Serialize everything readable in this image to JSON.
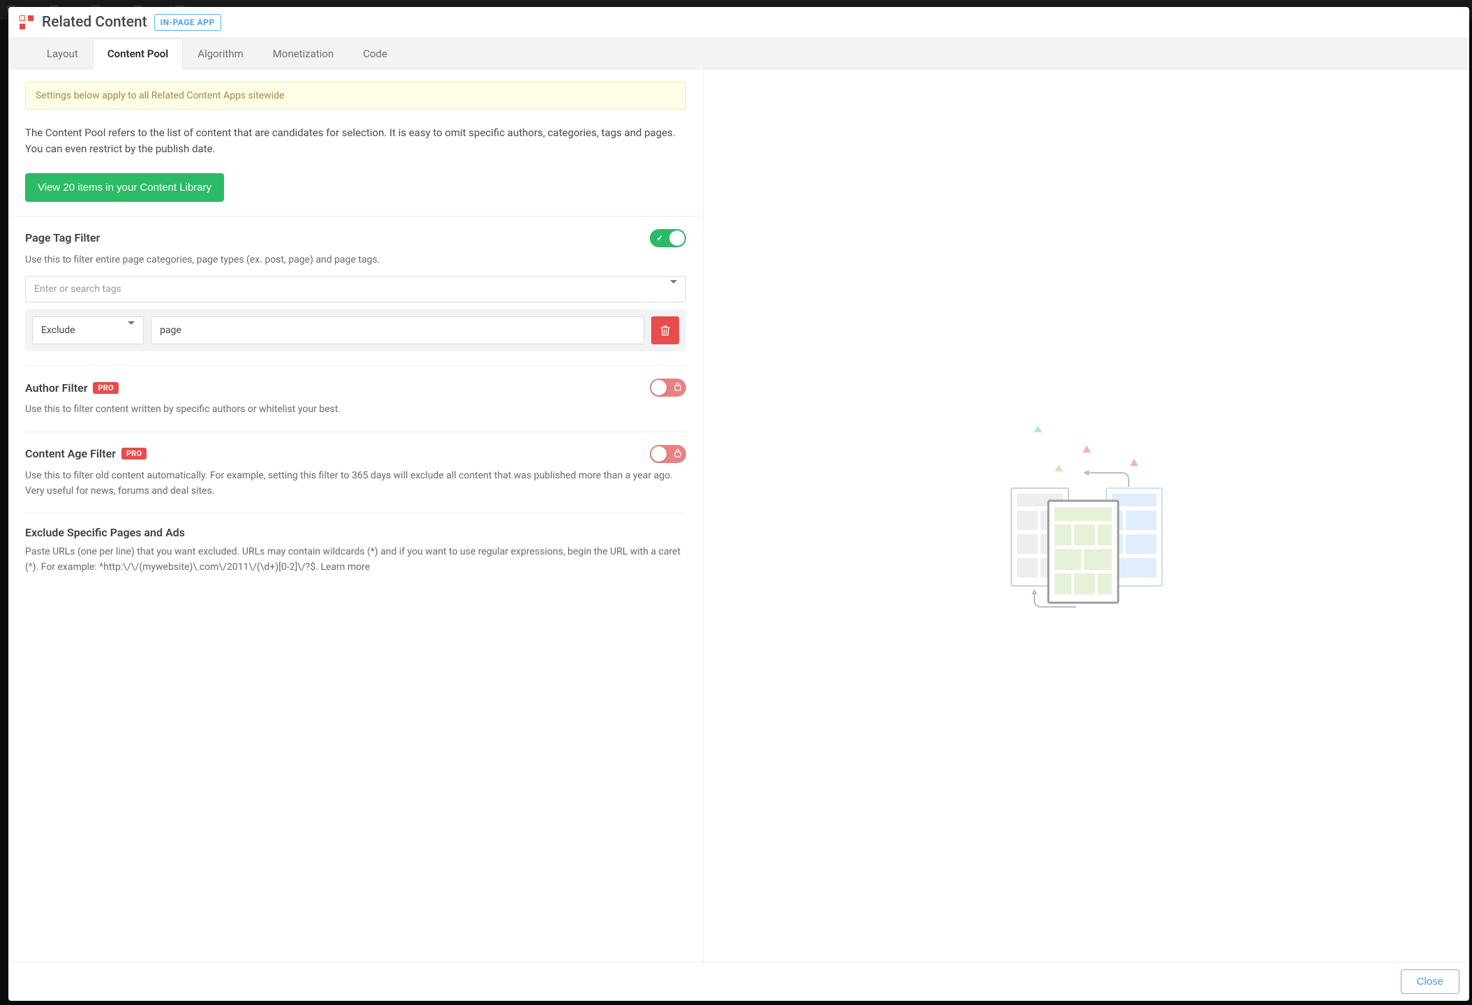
{
  "header": {
    "title": "Related Content",
    "badge": "IN-PAGE APP"
  },
  "tabs": [
    {
      "label": "Layout",
      "active": false
    },
    {
      "label": "Content Pool",
      "active": true
    },
    {
      "label": "Algorithm",
      "active": false
    },
    {
      "label": "Monetization",
      "active": false
    },
    {
      "label": "Code",
      "active": false
    }
  ],
  "notice": "Settings below apply to all Related Content Apps sitewide",
  "intro": "The Content Pool refers to the list of content that are candidates for selection. It is easy to omit specific authors, categories, tags and pages. You can even restrict by the publish date.",
  "view_library_btn": "View 20 items in your Content Library",
  "page_tag_filter": {
    "title": "Page Tag Filter",
    "desc": "Use this to filter entire page categories, page types (ex. post, page) and page tags.",
    "placeholder": "Enter or search tags",
    "rule_mode": "Exclude",
    "rule_value": "page"
  },
  "author_filter": {
    "title": "Author Filter",
    "pro": "PRO",
    "desc": "Use this to filter content written by specific authors or whitelist your best."
  },
  "content_age_filter": {
    "title": "Content Age Filter",
    "pro": "PRO",
    "desc": "Use this to filter old content automatically. For example, setting this filter to 365 days will exclude all content that was published more than a year ago. Very useful for news, forums and deal sites."
  },
  "exclude_pages": {
    "title": "Exclude Specific Pages and Ads",
    "desc": "Paste URLs (one per line) that you want excluded. URLs may contain wildcards (*) and if you want to use regular expressions, begin the URL with a caret (^). For example: ^http:\\/\\/(mywebsite)\\.com\\/2011\\/(\\d+)[0-2]\\/?$. Learn more"
  },
  "footer": {
    "close_btn": "Close"
  }
}
